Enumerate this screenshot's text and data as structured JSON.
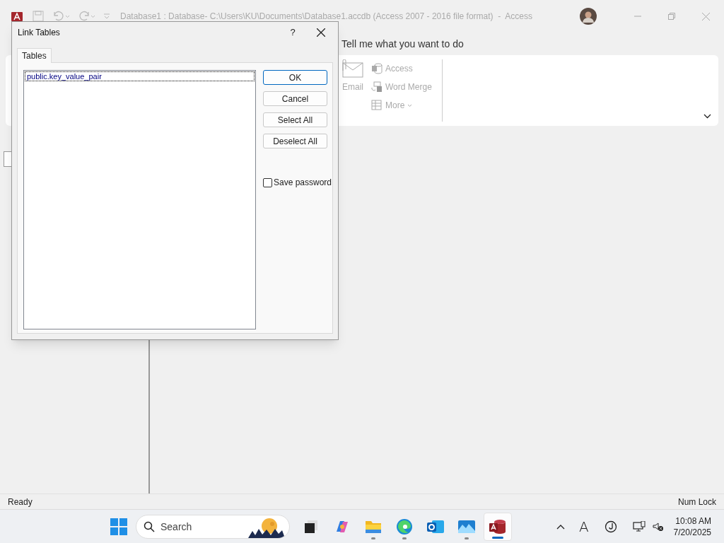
{
  "window": {
    "title": "Database1 : Database- C:\\Users\\KU\\Documents\\Database1.accdb (Access 2007 - 2016 file format)  -  Access"
  },
  "tell_me": "Tell me what you want to do",
  "ribbon": {
    "email": "Email",
    "items": [
      {
        "kind": "access",
        "label": "Access"
      },
      {
        "kind": "word",
        "label": "Word Merge"
      },
      {
        "kind": "more",
        "label": "More"
      }
    ]
  },
  "dialog": {
    "title": "Link Tables",
    "help": "?",
    "tabs": [
      {
        "label": "Tables",
        "selected": true
      }
    ],
    "tables": [
      {
        "label": "public.key_value_pair",
        "selected": false
      }
    ],
    "buttons": [
      {
        "label": "OK",
        "default": true
      },
      {
        "label": "Cancel",
        "default": false
      },
      {
        "label": "Select All",
        "default": false
      },
      {
        "label": "Deselect All",
        "default": false
      }
    ],
    "save_password": {
      "label": "Save password",
      "checked": false
    }
  },
  "status_bar": {
    "left": "Ready",
    "right": "Num Lock"
  },
  "taskbar": {
    "search": "Search",
    "apps": [
      {
        "kind": "taskview",
        "running": false,
        "selected": false
      },
      {
        "kind": "copilot",
        "running": false,
        "selected": false
      },
      {
        "kind": "explorer",
        "running": true,
        "selected": false
      },
      {
        "kind": "edge",
        "running": true,
        "selected": false
      },
      {
        "kind": "outlook",
        "running": false,
        "selected": false
      },
      {
        "kind": "photos",
        "running": true,
        "selected": false
      },
      {
        "kind": "access",
        "running": true,
        "selected": true
      }
    ],
    "ime": "A",
    "time": "10:08 AM",
    "date": "7/20/2025"
  }
}
